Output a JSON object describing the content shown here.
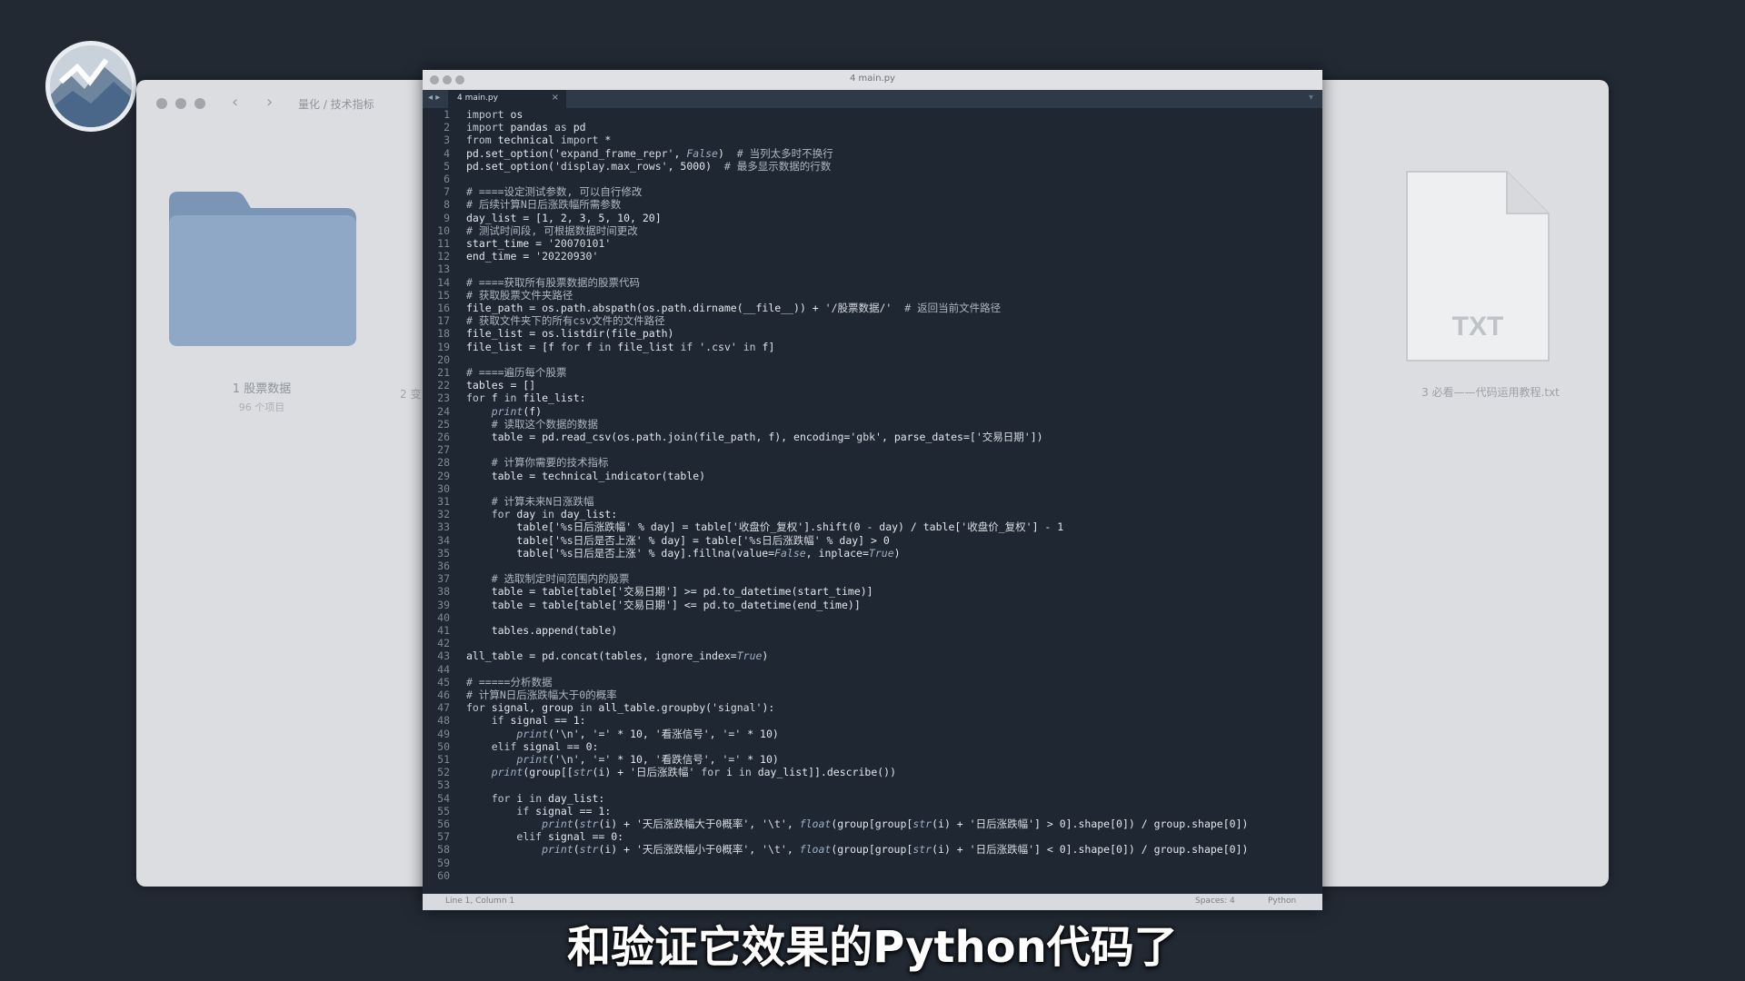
{
  "finder": {
    "path": "量化 / 技术指标",
    "folder_label": "1 股票数据",
    "folder_sub": "96 个项目",
    "ghost_label": "2 变",
    "txt_icon_text": "TXT",
    "txt_label": "3 必看——代码运用教程.txt"
  },
  "editor": {
    "window_title": "4 main.py",
    "tab_label": "4 main.py",
    "tab_close": "×",
    "status_left": "Line 1, Column 1",
    "status_spaces": "Spaces: 4",
    "status_lang": "Python",
    "lines": [
      "import os",
      "import pandas as pd",
      "from technical import *",
      "pd.set_option('expand_frame_repr', False)  # 当列太多时不换行",
      "pd.set_option('display.max_rows', 5000)  # 最多显示数据的行数",
      "",
      "# ====设定测试参数, 可以自行修改",
      "# 后续计算N日后涨跌幅所需参数",
      "day_list = [1, 2, 3, 5, 10, 20]",
      "# 测试时间段, 可根据数据时间更改",
      "start_time = '20070101'",
      "end_time = '20220930'",
      "",
      "# ====获取所有股票数据的股票代码",
      "# 获取股票文件夹路径",
      "file_path = os.path.abspath(os.path.dirname(__file__)) + '/股票数据/'  # 返回当前文件路径",
      "# 获取文件夹下的所有csv文件的文件路径",
      "file_list = os.listdir(file_path)",
      "file_list = [f for f in file_list if '.csv' in f]",
      "",
      "# ====遍历每个股票",
      "tables = []",
      "for f in file_list:",
      "    print(f)",
      "    # 读取这个数据的数据",
      "    table = pd.read_csv(os.path.join(file_path, f), encoding='gbk', parse_dates=['交易日期'])",
      "",
      "    # 计算你需要的技术指标",
      "    table = technical_indicator(table)",
      "",
      "    # 计算未来N日涨跌幅",
      "    for day in day_list:",
      "        table['%s日后涨跌幅' % day] = table['收盘价_复权'].shift(0 - day) / table['收盘价_复权'] - 1",
      "        table['%s日后是否上涨' % day] = table['%s日后涨跌幅' % day] > 0",
      "        table['%s日后是否上涨' % day].fillna(value=False, inplace=True)",
      "",
      "    # 选取制定时间范围内的股票",
      "    table = table[table['交易日期'] >= pd.to_datetime(start_time)]",
      "    table = table[table['交易日期'] <= pd.to_datetime(end_time)]",
      "",
      "    tables.append(table)",
      "",
      "all_table = pd.concat(tables, ignore_index=True)",
      "",
      "# =====分析数据",
      "# 计算N日后涨跌幅大于0的概率",
      "for signal, group in all_table.groupby('signal'):",
      "    if signal == 1:",
      "        print('\\n', '=' * 10, '看涨信号', '=' * 10)",
      "    elif signal == 0:",
      "        print('\\n', '=' * 10, '看跌信号', '=' * 10)",
      "    print(group[[str(i) + '日后涨跌幅' for i in day_list]].describe())",
      "",
      "    for i in day_list:",
      "        if signal == 1:",
      "            print(str(i) + '天后涨跌幅大于0概率', '\\t', float(group[group[str(i) + '日后涨跌幅'] > 0].shape[0]) / group.shape[0])",
      "        elif signal == 0:",
      "            print(str(i) + '天后涨跌幅小于0概率', '\\t', float(group[group[str(i) + '日后涨跌幅'] < 0].shape[0]) / group.shape[0])",
      "",
      ""
    ]
  },
  "subtitle": "和验证它效果的Python代码了"
}
